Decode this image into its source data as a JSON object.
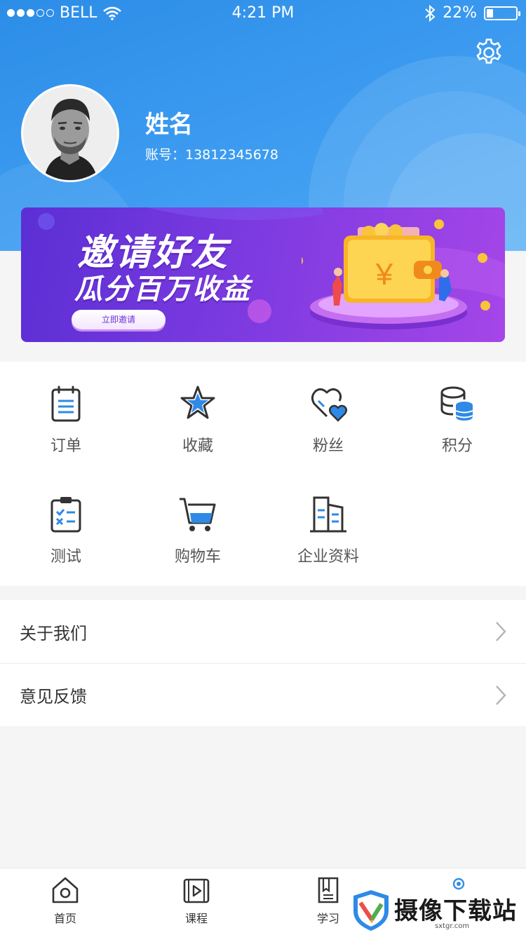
{
  "status_bar": {
    "carrier": "BELL",
    "time": "4:21 PM",
    "battery": "22%",
    "battery_level": 0.22
  },
  "header": {
    "background_color": "#3a98ee",
    "settings_icon": "gear-icon"
  },
  "profile": {
    "name": "姓名",
    "account": "账号：13812345678",
    "avatar": "avatar-photo"
  },
  "banner": {
    "title_line1": "邀请好友",
    "title_line2": "瓜分百万收益",
    "button_label": "立即邀请",
    "currency_symbol": "¥"
  },
  "grid": {
    "items": [
      {
        "label": "订单",
        "icon": "order-icon"
      },
      {
        "label": "收藏",
        "icon": "star-icon"
      },
      {
        "label": "粉丝",
        "icon": "heart-icon"
      },
      {
        "label": "积分",
        "icon": "coins-icon"
      },
      {
        "label": "测试",
        "icon": "clipboard-icon"
      },
      {
        "label": "购物车",
        "icon": "cart-icon"
      },
      {
        "label": "企业资料",
        "icon": "building-icon"
      }
    ]
  },
  "list": {
    "items": [
      {
        "label": "关于我们"
      },
      {
        "label": "意见反馈"
      }
    ]
  },
  "tabbar": {
    "items": [
      {
        "label": "首页",
        "icon": "home-icon"
      },
      {
        "label": "课程",
        "icon": "video-icon"
      },
      {
        "label": "学习",
        "icon": "book-icon"
      }
    ]
  },
  "watermark": {
    "text": "摄像下载站",
    "url": "sxtgr.com"
  },
  "colors": {
    "accent": "#2f8fe6",
    "icon_dark": "#333333",
    "icon_blue": "#2e8ae6"
  }
}
